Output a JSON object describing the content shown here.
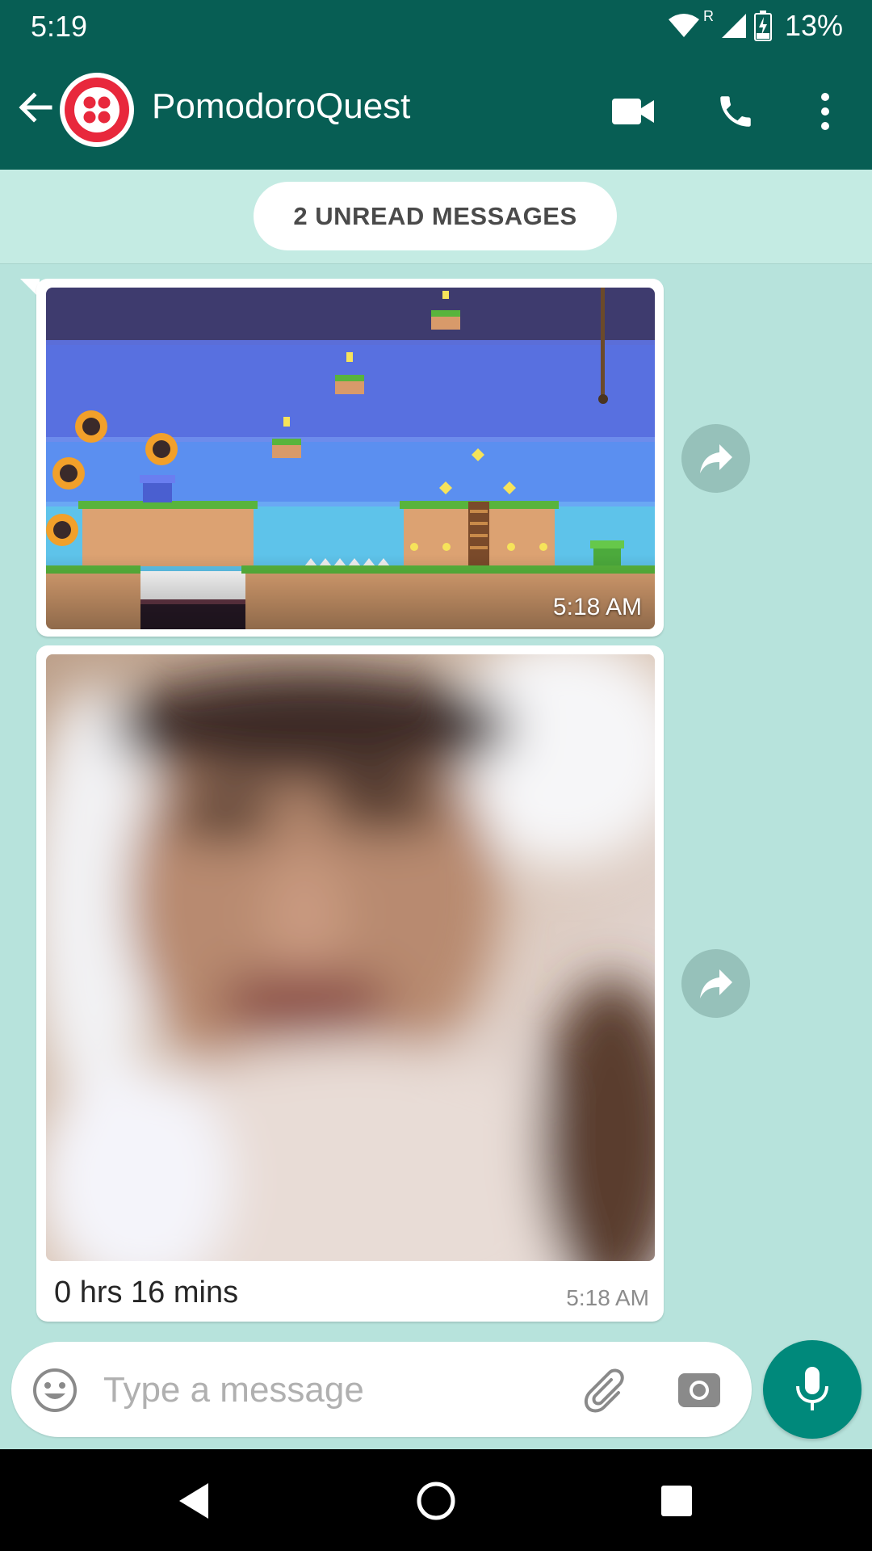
{
  "status_bar": {
    "time": "5:19",
    "battery": "13%",
    "roaming": "R"
  },
  "header": {
    "title": "PomodoroQuest",
    "icons": [
      "back-arrow-icon",
      "video-call-icon",
      "voice-call-icon",
      "more-vert-icon"
    ],
    "colors": {
      "bar": "#075e54",
      "avatar_logo": "#e8283c"
    }
  },
  "banner": {
    "unread": "2 UNREAD MESSAGES"
  },
  "messages": [
    {
      "type": "image",
      "content": "pixel-art platformer game screenshot",
      "time": "5:18 AM"
    },
    {
      "type": "image",
      "content": "blurred camera photo",
      "caption": "0 hrs 16 mins",
      "time": "5:18 AM"
    }
  ],
  "composer": {
    "placeholder": "Type a message",
    "mic_color": "#00897b"
  },
  "nav": {
    "icons": [
      "back-triangle-icon",
      "home-circle-icon",
      "recents-square-icon"
    ]
  }
}
